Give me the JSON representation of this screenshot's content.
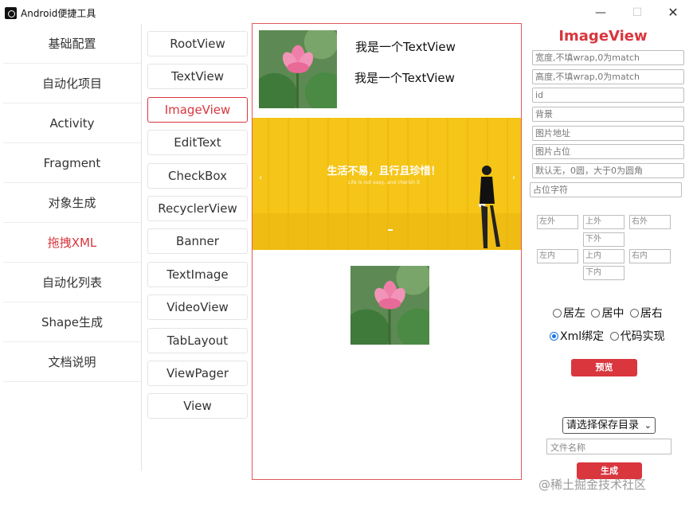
{
  "window": {
    "title": "Android便捷工具",
    "minimize": "—",
    "maximize": "☐",
    "close": "✕"
  },
  "menu": [
    {
      "label": "基础配置"
    },
    {
      "label": "自动化项目"
    },
    {
      "label": "Activity"
    },
    {
      "label": "Fragment"
    },
    {
      "label": "对象生成"
    },
    {
      "label": "拖拽XML",
      "active": true
    },
    {
      "label": "自动化列表"
    },
    {
      "label": "Shape生成"
    },
    {
      "label": "文档说明"
    }
  ],
  "components": [
    {
      "label": "RootView"
    },
    {
      "label": "TextView"
    },
    {
      "label": "ImageView",
      "active": true
    },
    {
      "label": "EditText"
    },
    {
      "label": "CheckBox"
    },
    {
      "label": "RecyclerView"
    },
    {
      "label": "Banner"
    },
    {
      "label": "TextImage"
    },
    {
      "label": "VideoView"
    },
    {
      "label": "TabLayout"
    },
    {
      "label": "ViewPager"
    },
    {
      "label": "View"
    }
  ],
  "preview": {
    "textview1": "我是一个TextView",
    "textview2": "我是一个TextView",
    "banner_headline": "生活不易，且行且珍惜！",
    "banner_sub": "Life is not easy, and cherish it"
  },
  "panel": {
    "title": "ImageView",
    "fields": {
      "width": "宽度,不填wrap,0为match",
      "height": "高度,不填wrap,0为match",
      "id": "id",
      "background": "背景",
      "src": "图片地址",
      "placeholder_img": "图片占位",
      "radius": "默认无，0圆，大于0为圆角",
      "placeholder_char": "占位字符"
    },
    "margin": {
      "left": "左外",
      "top": "上外",
      "right": "右外",
      "bottom": "下外"
    },
    "padding": {
      "left": "左内",
      "top": "上内",
      "right": "右内",
      "bottom": "下内"
    },
    "align": {
      "left": "居左",
      "center": "居中",
      "right": "居右"
    },
    "mode": {
      "xml": "Xml绑定",
      "code": "代码实现"
    },
    "preview_button": "预览",
    "save_dir": "请选择保存目录",
    "filename_placeholder": "文件名称",
    "generate_button": "生成"
  },
  "watermark": "@稀土掘金技术社区",
  "colors": {
    "accent": "#d9363e",
    "banner": "#f5c518",
    "radio": "#1a73e8"
  }
}
